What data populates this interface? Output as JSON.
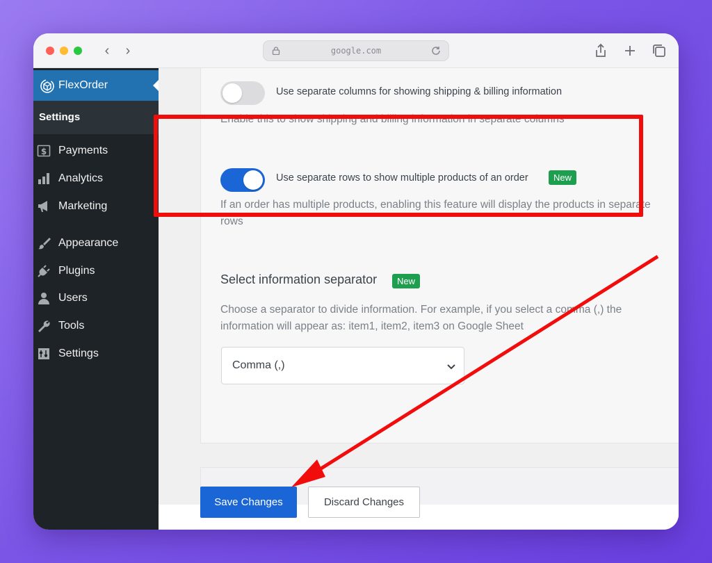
{
  "browser": {
    "url": "google.com",
    "nav_back": "‹",
    "nav_forward": "›"
  },
  "sidebar": {
    "brand": "FlexOrder",
    "submenu_active": "Settings",
    "items": [
      {
        "label": "Payments",
        "icon": "dollar-icon"
      },
      {
        "label": "Analytics",
        "icon": "bar-chart-icon"
      },
      {
        "label": "Marketing",
        "icon": "megaphone-icon"
      },
      {
        "label": "Appearance",
        "icon": "paintbrush-icon"
      },
      {
        "label": "Plugins",
        "icon": "plug-icon"
      },
      {
        "label": "Users",
        "icon": "user-icon"
      },
      {
        "label": "Tools",
        "icon": "wrench-icon"
      },
      {
        "label": "Settings",
        "icon": "settings-icon"
      }
    ]
  },
  "options": {
    "separate_columns": {
      "label": "Use separate columns for showing shipping & billing information",
      "description": "Enable this to show shipping and billing information in separate columns",
      "enabled": false
    },
    "separate_rows": {
      "label": "Use separate rows to show multiple products of an order",
      "badge": "New",
      "description_line1": "If an order has multiple products, enabling this feature will display the products in separate",
      "description_line2": "rows",
      "enabled": true
    },
    "separator": {
      "title": "Select information separator",
      "badge": "New",
      "description_line1": "Choose a separator to divide information. For example, if you select a comma (,) the",
      "description_line2": "information will appear as: item1, item2, item3 on Google Sheet",
      "selected": "Comma (,)"
    }
  },
  "actions": {
    "save": "Save Changes",
    "discard": "Discard Changes"
  },
  "colors": {
    "accent": "#1a66d6",
    "badge": "#1e9e4f",
    "highlight": "#f20d0d",
    "sidebar_bg": "#1e2327"
  }
}
